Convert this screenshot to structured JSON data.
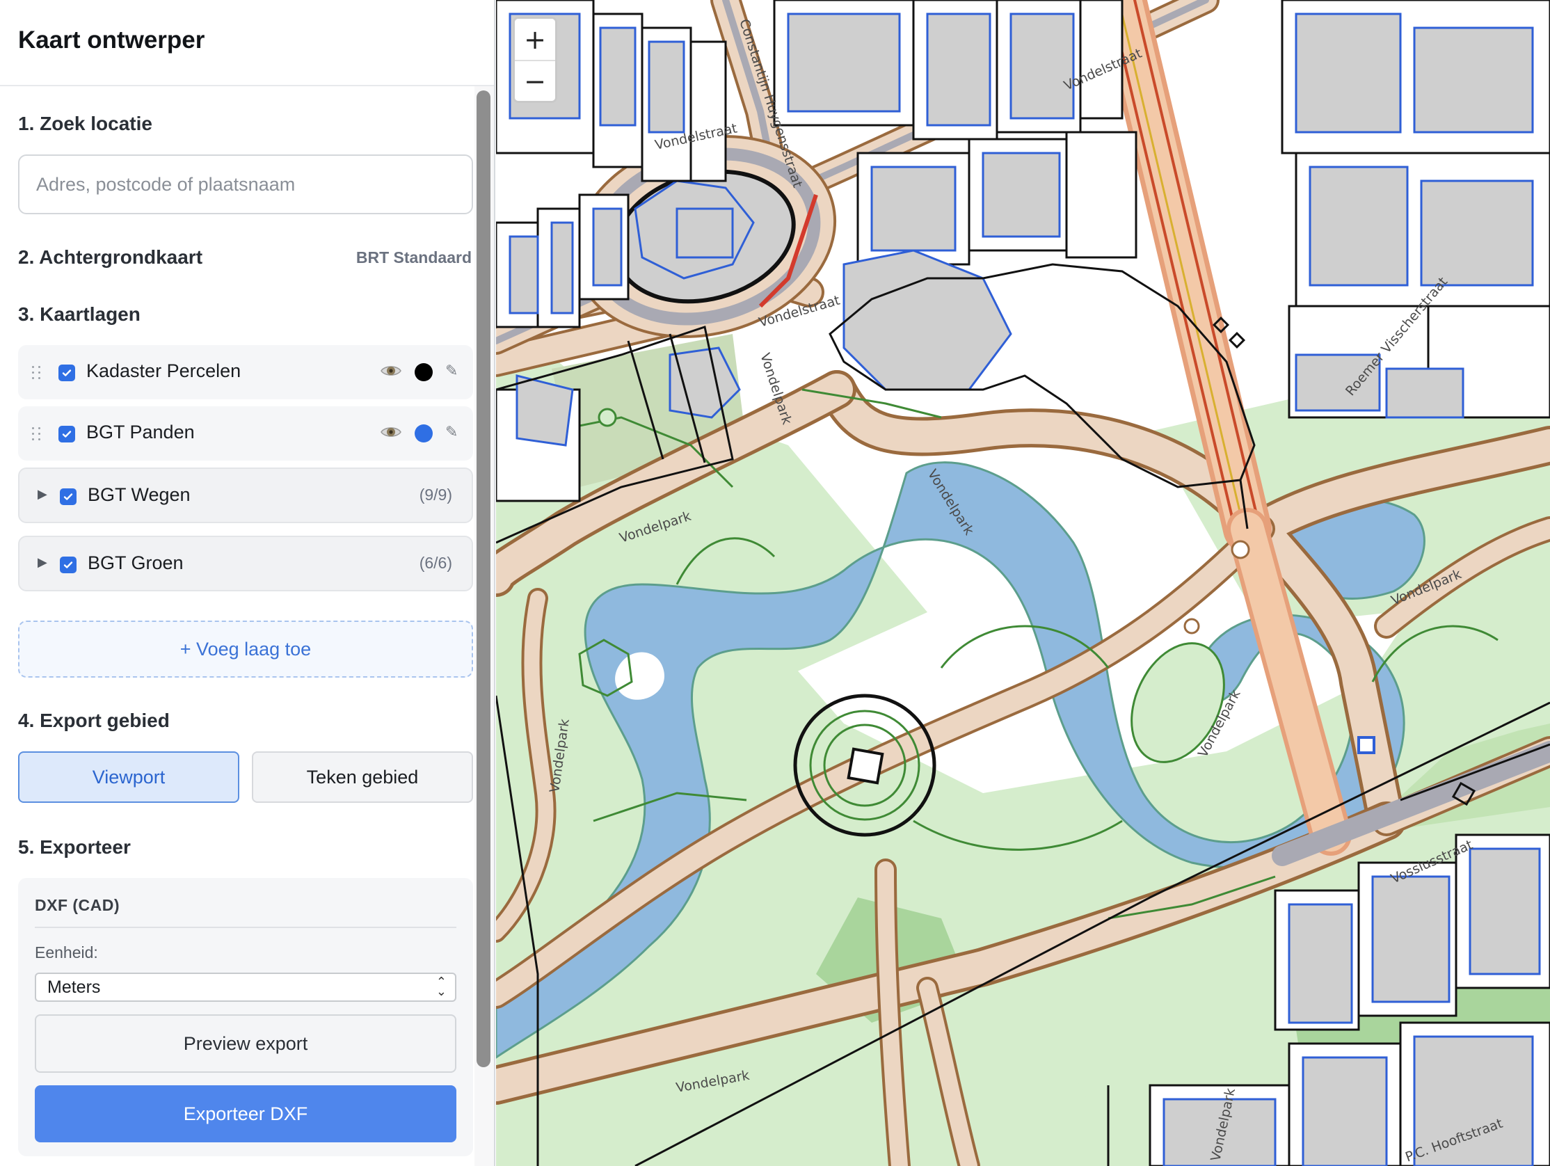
{
  "app": {
    "title": "Kaart ontwerper"
  },
  "search": {
    "title": "1. Zoek locatie",
    "placeholder": "Adres, postcode of plaatsnaam"
  },
  "basemap": {
    "title": "2. Achtergrondkaart",
    "value": "BRT Standaard"
  },
  "layers": {
    "title": "3. Kaartlagen",
    "items": [
      {
        "label": "Kadaster Percelen",
        "checked": true,
        "color": "#000000"
      },
      {
        "label": "BGT Panden",
        "checked": true,
        "color": "#2f6fe4"
      }
    ],
    "groups": [
      {
        "label": "BGT Wegen",
        "checked": true,
        "count": "(9/9)"
      },
      {
        "label": "BGT Groen",
        "checked": true,
        "count": "(6/6)"
      }
    ],
    "add_label": "+ Voeg laag toe"
  },
  "export_area": {
    "title": "4. Export gebied",
    "options": [
      "Viewport",
      "Teken gebied"
    ],
    "selected": "Viewport"
  },
  "exporter": {
    "title": "5. Exporteer",
    "format": "DXF (CAD)",
    "unit_label": "Eenheid:",
    "unit_value": "Meters",
    "preview_label": "Preview export",
    "export_label": "Exporteer DXF"
  },
  "map": {
    "zoom_in": "+",
    "zoom_out": "−",
    "streets": {
      "huygens": "Constantijn Huygensstraat",
      "vondelstraat_n": "Vondelstraat",
      "vondelstraat_w": "Vondelstraat",
      "vondelstraat_s": "Vondelstraat",
      "vondelpark_1": "Vondelpark",
      "vondelpark_2": "Vondelpark",
      "vondelpark_3": "Vondelpark",
      "vondelpark_4": "Vondelpark",
      "vondelpark_5": "Vondelpark",
      "vondelpark_6": "Vondelpark",
      "vondelpark_7": "Vondelpark",
      "vondelpark_8": "Vondelpark",
      "roemer": "Roemer Visscherstraat",
      "vossius": "Vossiusstraat",
      "cornelisz": "P.C. Hooftstraat"
    },
    "colors": {
      "water": "#8fb9de",
      "grass": "#d5edcc",
      "grass_dark": "#a9d59c",
      "road": "#ecd6c2",
      "road_edge": "#9a6a3e",
      "building": "#cfcfcf",
      "building_edge": "#2f5fd6",
      "parcel": "#111111",
      "green_edge": "#3f8a35"
    }
  }
}
